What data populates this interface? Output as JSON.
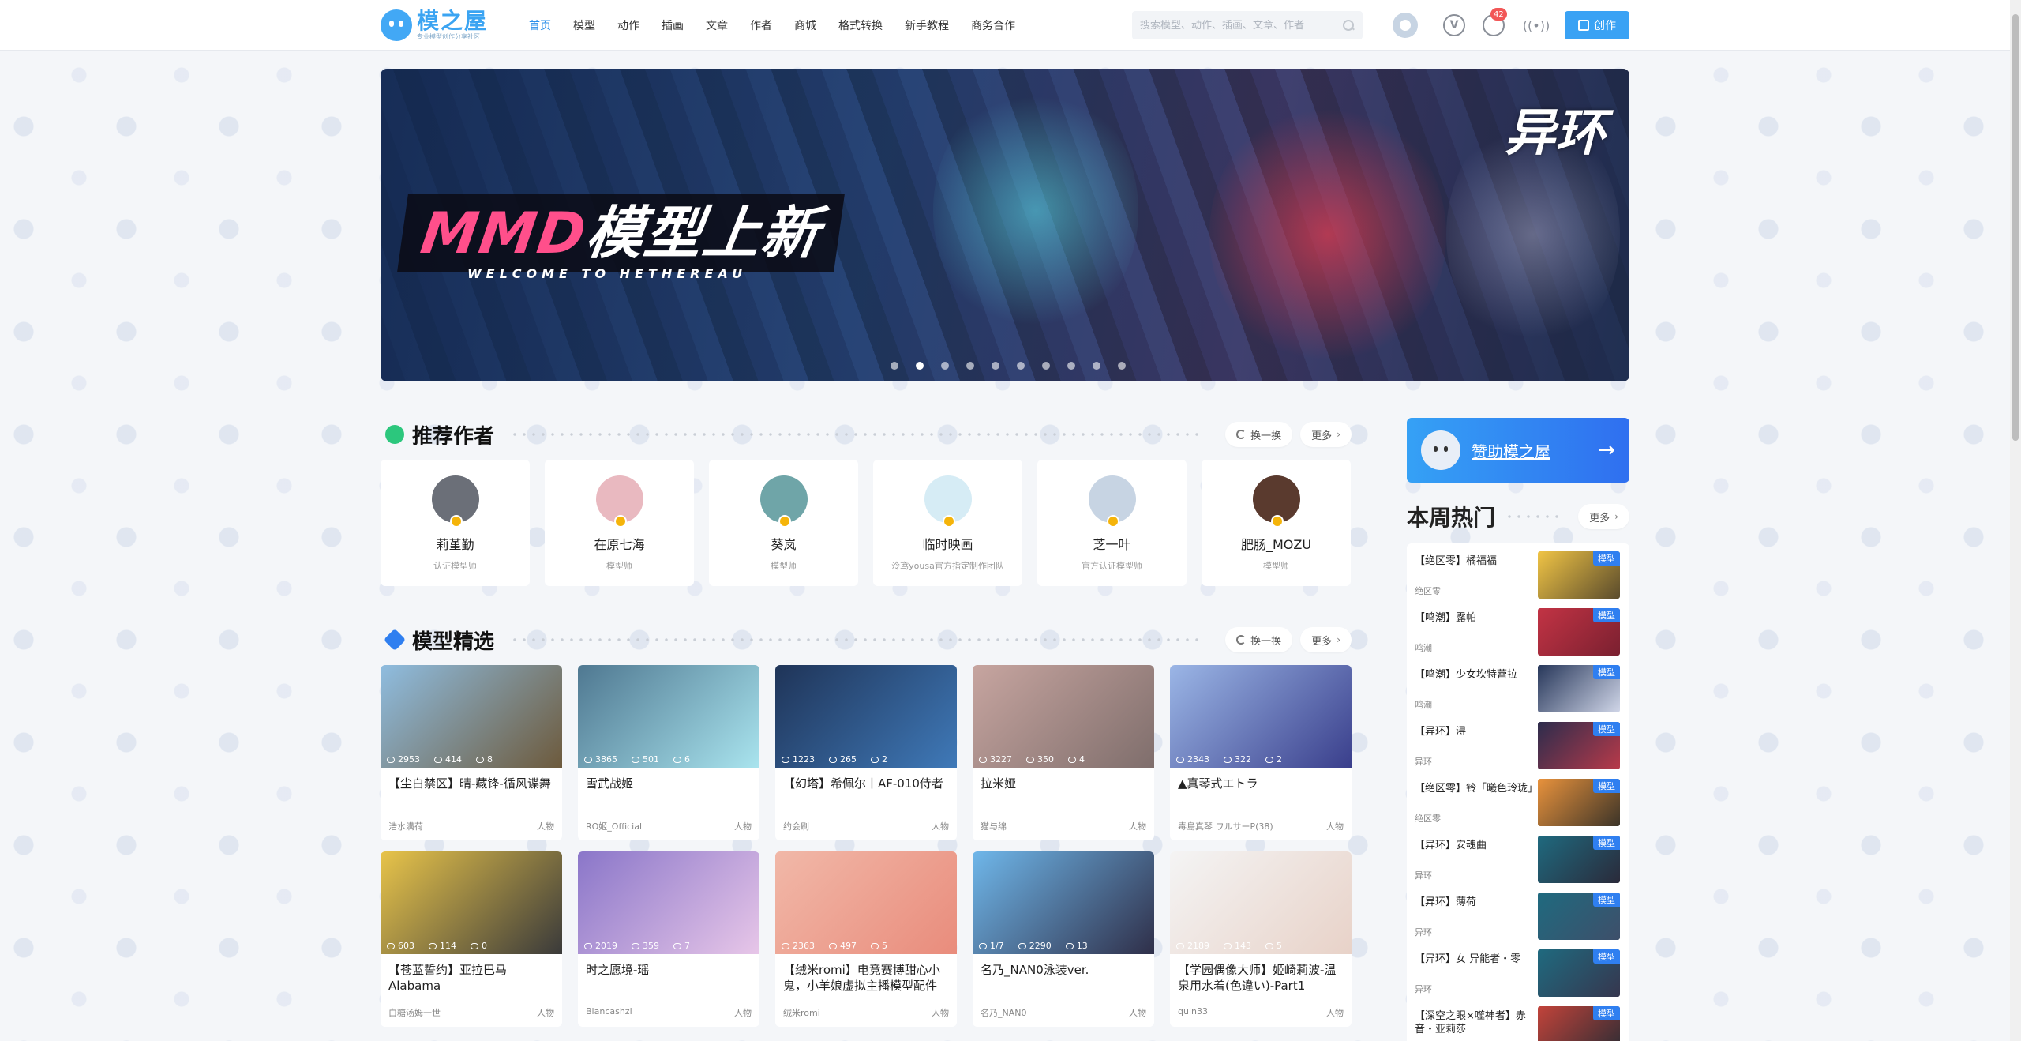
{
  "header": {
    "logo_title": "模之屋",
    "logo_sub": "专业模型创作分享社区",
    "nav": [
      {
        "label": "首页",
        "active": true
      },
      {
        "label": "模型"
      },
      {
        "label": "动作"
      },
      {
        "label": "插画"
      },
      {
        "label": "文章"
      },
      {
        "label": "作者"
      },
      {
        "label": "商城"
      },
      {
        "label": "格式转换"
      },
      {
        "label": "新手教程"
      },
      {
        "label": "商务合作"
      }
    ],
    "search_placeholder": "搜索模型、动作、插画、文章、作者",
    "vip_label": "V",
    "message_count": "42",
    "create_label": "创作"
  },
  "banner": {
    "title_en": "MMD",
    "title_cn": "模型上新",
    "subtitle": "WELCOME TO HETHEREAU",
    "brand": "异环",
    "slides": 10,
    "active_slide": 1
  },
  "authors_section": {
    "title": "推荐作者",
    "refresh_label": "换一换",
    "more_label": "更多",
    "items": [
      {
        "name": "莉堇勤",
        "role": "认证模型师",
        "color": "#6b6f78"
      },
      {
        "name": "在原七海",
        "role": "模型师",
        "color": "#e9b9c0"
      },
      {
        "name": "葵岚",
        "role": "模型师",
        "color": "#6fa5a8"
      },
      {
        "name": "临时映画",
        "role": "泠鸢yousa官方指定制作团队",
        "color": "#d6ecf5"
      },
      {
        "name": "芝一叶",
        "role": "官方认证模型师",
        "color": "#c7d4e3"
      },
      {
        "name": "肥肠_MOZU",
        "role": "模型师",
        "color": "#5a3a2e"
      }
    ]
  },
  "models_section": {
    "title": "模型精选",
    "refresh_label": "换一换",
    "more_label": "更多",
    "items": [
      {
        "title": "【尘白禁区】晴-藏锋-循风谍舞",
        "author": "浩水满荷",
        "category": "人物",
        "views": "2953",
        "likes": "414",
        "comments": "8",
        "c1": "#8fbde0",
        "c2": "#6d5a3c"
      },
      {
        "title": "雪武战姬",
        "author": "RO姬_Official",
        "category": "人物",
        "views": "3865",
        "likes": "501",
        "comments": "6",
        "c1": "#4f7891",
        "c2": "#a9e4ee"
      },
      {
        "title": "【幻塔】希佩尔丨AF-010侍者",
        "author": "约会刷",
        "category": "人物",
        "views": "1223",
        "likes": "265",
        "comments": "2",
        "c1": "#1f3458",
        "c2": "#3f79b8"
      },
      {
        "title": "拉米娅",
        "author": "猫与绵",
        "category": "人物",
        "views": "3227",
        "likes": "350",
        "comments": "4",
        "c1": "#c7a5a0",
        "c2": "#7f6e6c"
      },
      {
        "title": "▲真琴式エトラ",
        "author": "毒島真琴 ワルサーP(38)",
        "category": "人物",
        "views": "2343",
        "likes": "322",
        "comments": "2",
        "c1": "#9bb6e6",
        "c2": "#3a3f8c"
      },
      {
        "title": "【苍蓝誓约】亚拉巴马Alabama",
        "author": "白糖汤姆一世",
        "category": "人物",
        "views": "603",
        "likes": "114",
        "comments": "0",
        "c1": "#e8c44a",
        "c2": "#3a3a3a"
      },
      {
        "title": "时之愿境-瑶",
        "author": "Biancashzl",
        "category": "人物",
        "views": "2019",
        "likes": "359",
        "comments": "7",
        "c1": "#8a76c9",
        "c2": "#e7c6e8"
      },
      {
        "title": "【绒米romi】电竞赛博甜心小鬼，小羊娘虚拟主播模型配件",
        "author": "绒米romi",
        "category": "人物",
        "views": "2363",
        "likes": "497",
        "comments": "5",
        "c1": "#f1b8a8",
        "c2": "#e98c7c"
      },
      {
        "title": "名乃_NAN0泳装ver.",
        "author": "名乃_NAN0",
        "category": "人物",
        "views": "1/7",
        "likes": "2290",
        "comments": "13",
        "c1": "#6fb7ea",
        "c2": "#2f2f49"
      },
      {
        "title": "【学园偶像大师】姬崎莉波-温泉用水着(色違い)-Part1",
        "author": "quin33",
        "category": "人物",
        "views": "2189",
        "likes": "143",
        "comments": "5",
        "c1": "#f4f4f4",
        "c2": "#e8d2c8"
      }
    ]
  },
  "sidebar": {
    "sponsor_label": "赞助模之屋",
    "hot_title": "本周热门",
    "more_label": "更多",
    "tag_label": "模型",
    "items": [
      {
        "name": "【绝区零】橘福福",
        "category": "绝区零",
        "c1": "#f0c445",
        "c2": "#5a4b2c"
      },
      {
        "name": "【鸣潮】露帕",
        "category": "鸣潮",
        "c1": "#c23344",
        "c2": "#7a2030"
      },
      {
        "name": "【鸣潮】少女坎特蕾拉",
        "category": "鸣潮",
        "c1": "#27375a",
        "c2": "#d0d6e8"
      },
      {
        "name": "【异环】浔",
        "category": "异环",
        "c1": "#2c2c4c",
        "c2": "#b83a4a"
      },
      {
        "name": "【绝区零】铃「曦色玲珑」",
        "category": "绝区零",
        "c1": "#e8923c",
        "c2": "#3c3428"
      },
      {
        "name": "【异环】安魂曲",
        "category": "异环",
        "c1": "#1f6a7f",
        "c2": "#2a2a3a"
      },
      {
        "name": "【异环】薄荷",
        "category": "异环",
        "c1": "#1f6a7f",
        "c2": "#3e4f6a"
      },
      {
        "name": "【异环】女 异能者・零",
        "category": "异环",
        "c1": "#1f6a7f",
        "c2": "#36364e"
      },
      {
        "name": "【深空之眼×噬神者】赤音・亚莉莎",
        "category": "",
        "c1": "#c2433a",
        "c2": "#2c2c34"
      }
    ]
  }
}
